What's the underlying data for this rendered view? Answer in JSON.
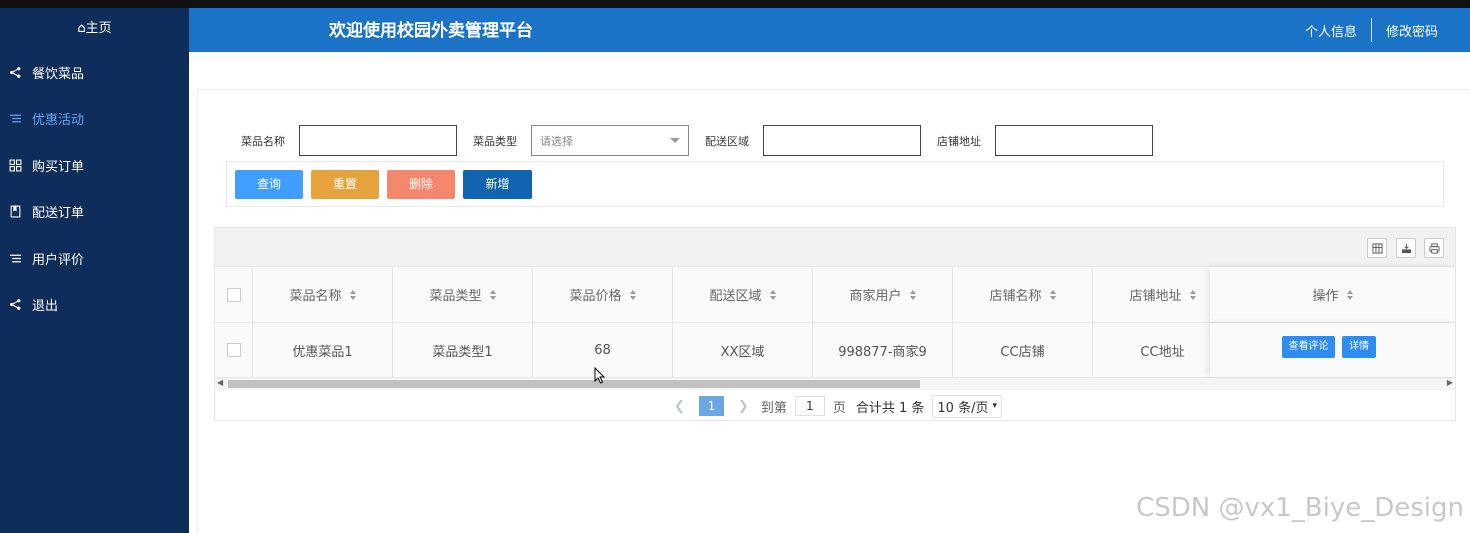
{
  "sidebar": {
    "home_label": "⌂主页",
    "items": [
      {
        "label": "餐饮菜品",
        "icon": "share-icon"
      },
      {
        "label": "优惠活动",
        "icon": "list-icon",
        "active": true
      },
      {
        "label": "购买订单",
        "icon": "grid-icon"
      },
      {
        "label": "配送订单",
        "icon": "book-icon"
      },
      {
        "label": "用户评价",
        "icon": "list-icon"
      },
      {
        "label": "退出",
        "icon": "share-icon"
      }
    ]
  },
  "header": {
    "title": "欢迎使用校园外卖管理平台",
    "profile_link": "个人信息",
    "password_link": "修改密码"
  },
  "filters": {
    "dish_name_label": "菜品名称",
    "dish_type_label": "菜品类型",
    "dish_type_placeholder": "请选择",
    "delivery_area_label": "配送区域",
    "shop_address_label": "店铺地址"
  },
  "buttons": {
    "search": "查询",
    "reset": "重置",
    "delete": "删除",
    "add": "新增"
  },
  "table": {
    "columns": [
      "菜品名称",
      "菜品类型",
      "菜品价格",
      "配送区域",
      "商家用户",
      "店铺名称",
      "店铺地址",
      "操作"
    ],
    "rows": [
      {
        "dish_name": "优惠菜品1",
        "dish_type": "菜品类型1",
        "price": "68",
        "area": "XX区域",
        "merchant": "998877-商家9",
        "shop_name": "CC店铺",
        "shop_address": "CC地址"
      }
    ],
    "row_actions": {
      "view_comments": "查看评论",
      "details": "详情"
    }
  },
  "pagination": {
    "current_page": "1",
    "goto_prefix": "到第",
    "goto_value": "1",
    "goto_suffix": "页",
    "total": "合计共 1 条",
    "page_size": "10 条/页"
  },
  "watermark": "CSDN @vx1_Biye_Design",
  "colors": {
    "sidebar_bg": "#0f2d5b",
    "header_bg": "#1a73c7",
    "search_btn": "#409eff",
    "reset_btn": "#e6a23c",
    "delete_btn": "#f5876d",
    "add_btn": "#1064b0"
  }
}
